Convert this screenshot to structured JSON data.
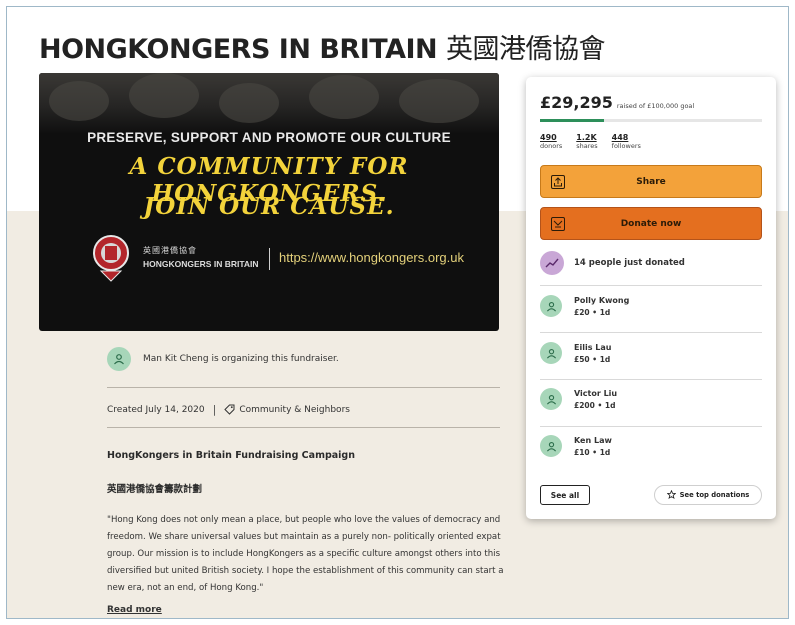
{
  "page": {
    "title": "HONGKONGERS IN BRITAIN",
    "title_cjk": "英國港僑協會"
  },
  "hero": {
    "tagline": "PRESERVE, SUPPORT AND PROMOTE OUR CULTURE",
    "headline_1": "A COMMUNITY FOR HONGKONGERS.",
    "headline_2": "JOIN OUR CAUSE.",
    "org_cjk": "英國港僑協會",
    "org_en": "HONGKONGERS IN BRITAIN",
    "url": "https://www.hongkongers.org.uk"
  },
  "organizer": {
    "text": "Man Kit Cheng is organizing this fundraiser."
  },
  "details": {
    "created": "Created July 14, 2020",
    "separator": "|",
    "category": "Community & Neighbors"
  },
  "campaign": {
    "title": "HongKongers in Britain Fundraising Campaign",
    "title_cjk": "英國港僑協會籌款計劃",
    "description": "\"Hong Kong does not only mean a place, but people who love the values of democracy and freedom. We share universal values but maintain as a purely non- politically oriented expat group. Our mission is to include HongKongers as a specific culture amongst others into this diversified but united British society. I hope the establishment of this community can start a new era, not an end, of Hong Kong.\"",
    "read_more": "Read more"
  },
  "donation_card": {
    "raised": "£29,295",
    "goal_text": "raised of £100,000 goal",
    "progress_fraction": 0.29,
    "stats": [
      {
        "value": "490",
        "label": "donors"
      },
      {
        "value": "1.2K",
        "label": "shares"
      },
      {
        "value": "448",
        "label": "followers"
      }
    ],
    "share_label": "Share",
    "donate_label": "Donate now",
    "just_donated": "14 people just donated",
    "donors": [
      {
        "name": "Polly Kwong",
        "amount": "£20",
        "dot": "•",
        "time": "1d"
      },
      {
        "name": "Eilis Lau",
        "amount": "£50",
        "dot": "•",
        "time": "1d"
      },
      {
        "name": "Victor Liu",
        "amount": "£200",
        "dot": "•",
        "time": "1d"
      },
      {
        "name": "Ken Law",
        "amount": "£10",
        "dot": "•",
        "time": "1d"
      }
    ],
    "see_all_label": "See all",
    "top_donations_label": "See top donations"
  },
  "colors": {
    "share_button": "#f3a23a",
    "donate_button": "#e46f1f",
    "progress": "#2d8f5a",
    "avatar": "#a7d6b9",
    "beige_background": "#f1ece3",
    "headline_yellow": "#f3d33b"
  },
  "icons": {
    "avatar": "person-icon",
    "category": "tag-icon",
    "share": "share-icon",
    "donate": "donate-icon",
    "trend": "trending-icon",
    "star": "star-icon"
  }
}
